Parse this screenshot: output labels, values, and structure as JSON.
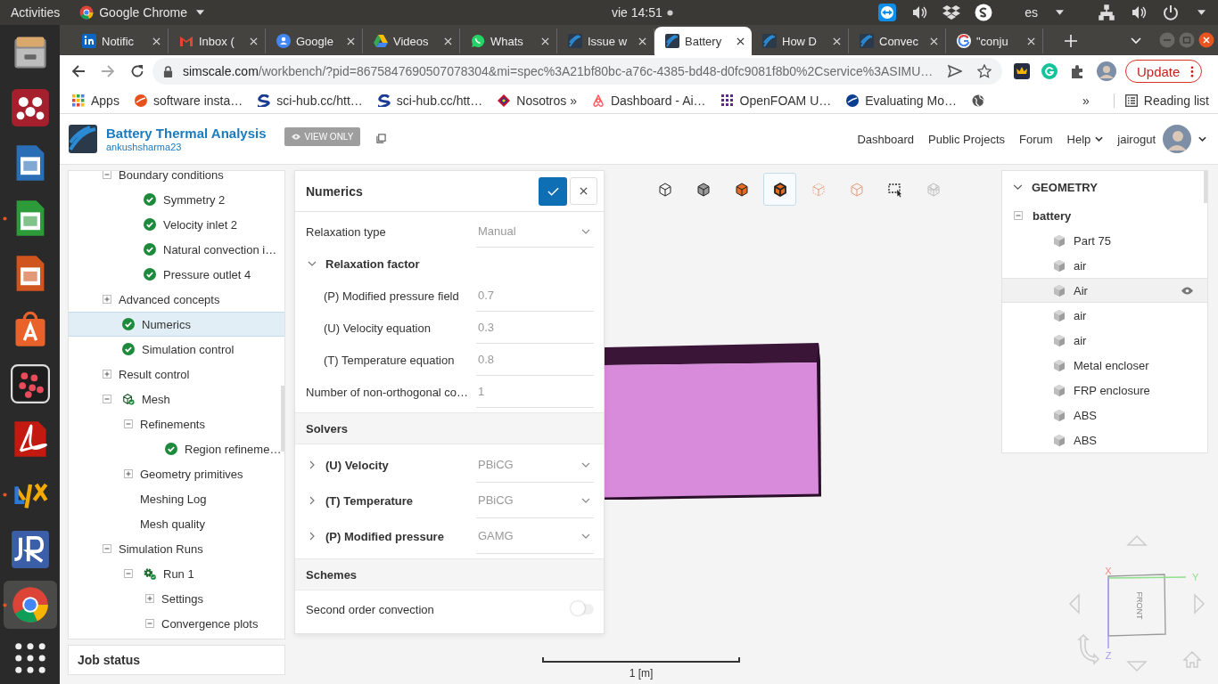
{
  "topbar": {
    "activities": "Activities",
    "app": "Google Chrome",
    "clock": "vie 14:51",
    "language": "es"
  },
  "dock": [
    {
      "kind": "files",
      "running": false,
      "selected": false
    },
    {
      "kind": "mendeley",
      "running": false,
      "selected": false
    },
    {
      "kind": "writer",
      "running": false,
      "selected": false
    },
    {
      "kind": "calc",
      "running": true,
      "selected": false
    },
    {
      "kind": "impress",
      "running": false,
      "selected": false
    },
    {
      "kind": "store",
      "running": false,
      "selected": false
    },
    {
      "kind": "dots",
      "running": false,
      "selected": false
    },
    {
      "kind": "acrobat",
      "running": false,
      "selected": false
    },
    {
      "kind": "lyx",
      "running": true,
      "selected": false
    },
    {
      "kind": "tile",
      "running": false,
      "selected": false
    },
    {
      "kind": "chrome",
      "running": true,
      "selected": true
    },
    {
      "kind": "grid",
      "running": false,
      "selected": false
    }
  ],
  "tabs": [
    {
      "title": "Notific",
      "kind": "linkedin",
      "selected": false
    },
    {
      "title": "Inbox (",
      "kind": "gmail",
      "selected": false
    },
    {
      "title": "Google",
      "kind": "contacts",
      "selected": false
    },
    {
      "title": "Videos",
      "kind": "drive",
      "selected": false
    },
    {
      "title": "Whats",
      "kind": "whatsapp",
      "selected": false
    },
    {
      "title": "Issue w",
      "kind": "simscale",
      "selected": false
    },
    {
      "title": "Battery",
      "kind": "simscale",
      "selected": true
    },
    {
      "title": "How D",
      "kind": "simscale",
      "selected": false
    },
    {
      "title": "Convec",
      "kind": "simscale",
      "selected": false
    },
    {
      "title": "\"conju",
      "kind": "google",
      "selected": false
    }
  ],
  "address": {
    "host": "simscale.com",
    "path": "/workbench/?pid=8675847690507078304&mi=spec%3A21bf80bc-a76c-4385-bd48-d0fc9081f8b0%2Cservice%3ASIMU…"
  },
  "update_button": "Update",
  "bookmarks": [
    {
      "label": "Apps",
      "kind": "apps"
    },
    {
      "label": "software insta…",
      "kind": "ask"
    },
    {
      "label": "sci-hub.cc/htt…",
      "kind": "scihub"
    },
    {
      "label": "sci-hub.cc/htt…",
      "kind": "scihub"
    },
    {
      "label": "Nosotros »",
      "kind": "diamond"
    },
    {
      "label": "Dashboard - Ai…",
      "kind": "airbnb"
    },
    {
      "label": "OpenFOAM U…",
      "kind": "dotgrid"
    },
    {
      "label": "Evaluating Mo…",
      "kind": "nasa"
    },
    {
      "kind": "globe"
    }
  ],
  "bookmarks_more": "»",
  "reading_list": "Reading list",
  "project": {
    "title": "Battery Thermal Analysis",
    "owner": "ankushsharma23",
    "badge": "VIEW ONLY"
  },
  "nav": [
    "Dashboard",
    "Public Projects",
    "Forum",
    "Help"
  ],
  "user": "jairogut",
  "tree": [
    {
      "label": "Boundary conditions",
      "kind": "plain",
      "expanded": true,
      "selected": false,
      "children": [
        {
          "label": "Symmetry 2",
          "kind": "check",
          "selected": false
        },
        {
          "label": "Velocity inlet 2",
          "kind": "check",
          "selected": false
        },
        {
          "label": "Natural convection i…",
          "kind": "check",
          "selected": false
        },
        {
          "label": "Pressure outlet 4",
          "kind": "check",
          "selected": false
        }
      ]
    },
    {
      "label": "Advanced concepts",
      "kind": "plain",
      "expanded": false,
      "selected": false
    },
    {
      "label": "Numerics",
      "kind": "check",
      "selected": true
    },
    {
      "label": "Simulation control",
      "kind": "check",
      "selected": false
    },
    {
      "label": "Result control",
      "kind": "plain",
      "expanded": false,
      "selected": false
    },
    {
      "label": "Mesh",
      "kind": "mesh",
      "expanded": true,
      "selected": false,
      "children": [
        {
          "label": "Refinements",
          "kind": "plain",
          "expanded": true,
          "selected": false,
          "children": [
            {
              "label": "Region refineme…",
              "kind": "check",
              "selected": false
            }
          ]
        },
        {
          "label": "Geometry primitives",
          "kind": "plain",
          "expanded": false,
          "selected": false
        },
        {
          "label": "Meshing Log",
          "kind": "plain",
          "selected": false
        },
        {
          "label": "Mesh quality",
          "kind": "plain",
          "selected": false
        }
      ]
    },
    {
      "label": "Simulation Runs",
      "kind": "plain",
      "expanded": true,
      "selected": false,
      "children": [
        {
          "label": "Run 1",
          "kind": "run",
          "expanded": true,
          "selected": false,
          "children": [
            {
              "label": "Settings",
              "kind": "plain",
              "expanded": false,
              "selected": false
            },
            {
              "label": "Convergence plots",
              "kind": "plain",
              "expanded": true,
              "selected": false
            }
          ]
        }
      ]
    }
  ],
  "job_status": "Job status",
  "numerics": {
    "title": "Numerics",
    "rows": [
      {
        "kind": "select",
        "label": "Relaxation type",
        "value": "Manual"
      },
      {
        "kind": "group",
        "label": "Relaxation factor",
        "expanded": true,
        "children": [
          {
            "kind": "input",
            "label": "(P) Modified pressure field",
            "value": "0.7"
          },
          {
            "kind": "input",
            "label": "(U) Velocity equation",
            "value": "0.3"
          },
          {
            "kind": "input",
            "label": "(T) Temperature equation",
            "value": "0.8"
          }
        ]
      },
      {
        "kind": "input",
        "label": "Number of non-orthogonal co…",
        "value": "1"
      },
      {
        "kind": "section",
        "label": "Solvers"
      },
      {
        "kind": "solver",
        "label": "(U) Velocity",
        "value": "PBiCG",
        "expanded": false
      },
      {
        "kind": "solver",
        "label": "(T) Temperature",
        "value": "PBiCG",
        "expanded": false
      },
      {
        "kind": "solver",
        "label": "(P) Modified pressure",
        "value": "GAMG",
        "expanded": false
      },
      {
        "kind": "section",
        "label": "Schemes"
      },
      {
        "kind": "toggle",
        "label": "Second order convection",
        "on": false
      }
    ]
  },
  "view_tools": [
    {
      "kind": "wireframe",
      "selected": false
    },
    {
      "kind": "solid",
      "selected": false
    },
    {
      "kind": "surface",
      "selected": false
    },
    {
      "kind": "edges",
      "selected": true
    },
    {
      "kind": "points",
      "selected": false
    },
    {
      "kind": "transparent",
      "selected": false
    },
    {
      "kind": "select",
      "selected": false
    },
    {
      "kind": "mesh",
      "selected": false
    }
  ],
  "geometry": {
    "title": "GEOMETRY",
    "expanded": true,
    "root": {
      "label": "battery",
      "expanded": true,
      "children": [
        {
          "label": "Part 75",
          "selected": false
        },
        {
          "label": "air",
          "selected": false
        },
        {
          "label": "Air",
          "selected": true
        },
        {
          "label": "air",
          "selected": false
        },
        {
          "label": "air",
          "selected": false
        },
        {
          "label": "Metal encloser",
          "selected": false
        },
        {
          "label": "FRP enclosure",
          "selected": false
        },
        {
          "label": "ABS",
          "selected": false
        },
        {
          "label": "ABS",
          "selected": false
        }
      ]
    }
  },
  "view_cube": {
    "face": "FRONT",
    "axes": [
      "X",
      "Y",
      "Z"
    ]
  },
  "scale": "1 [m]"
}
